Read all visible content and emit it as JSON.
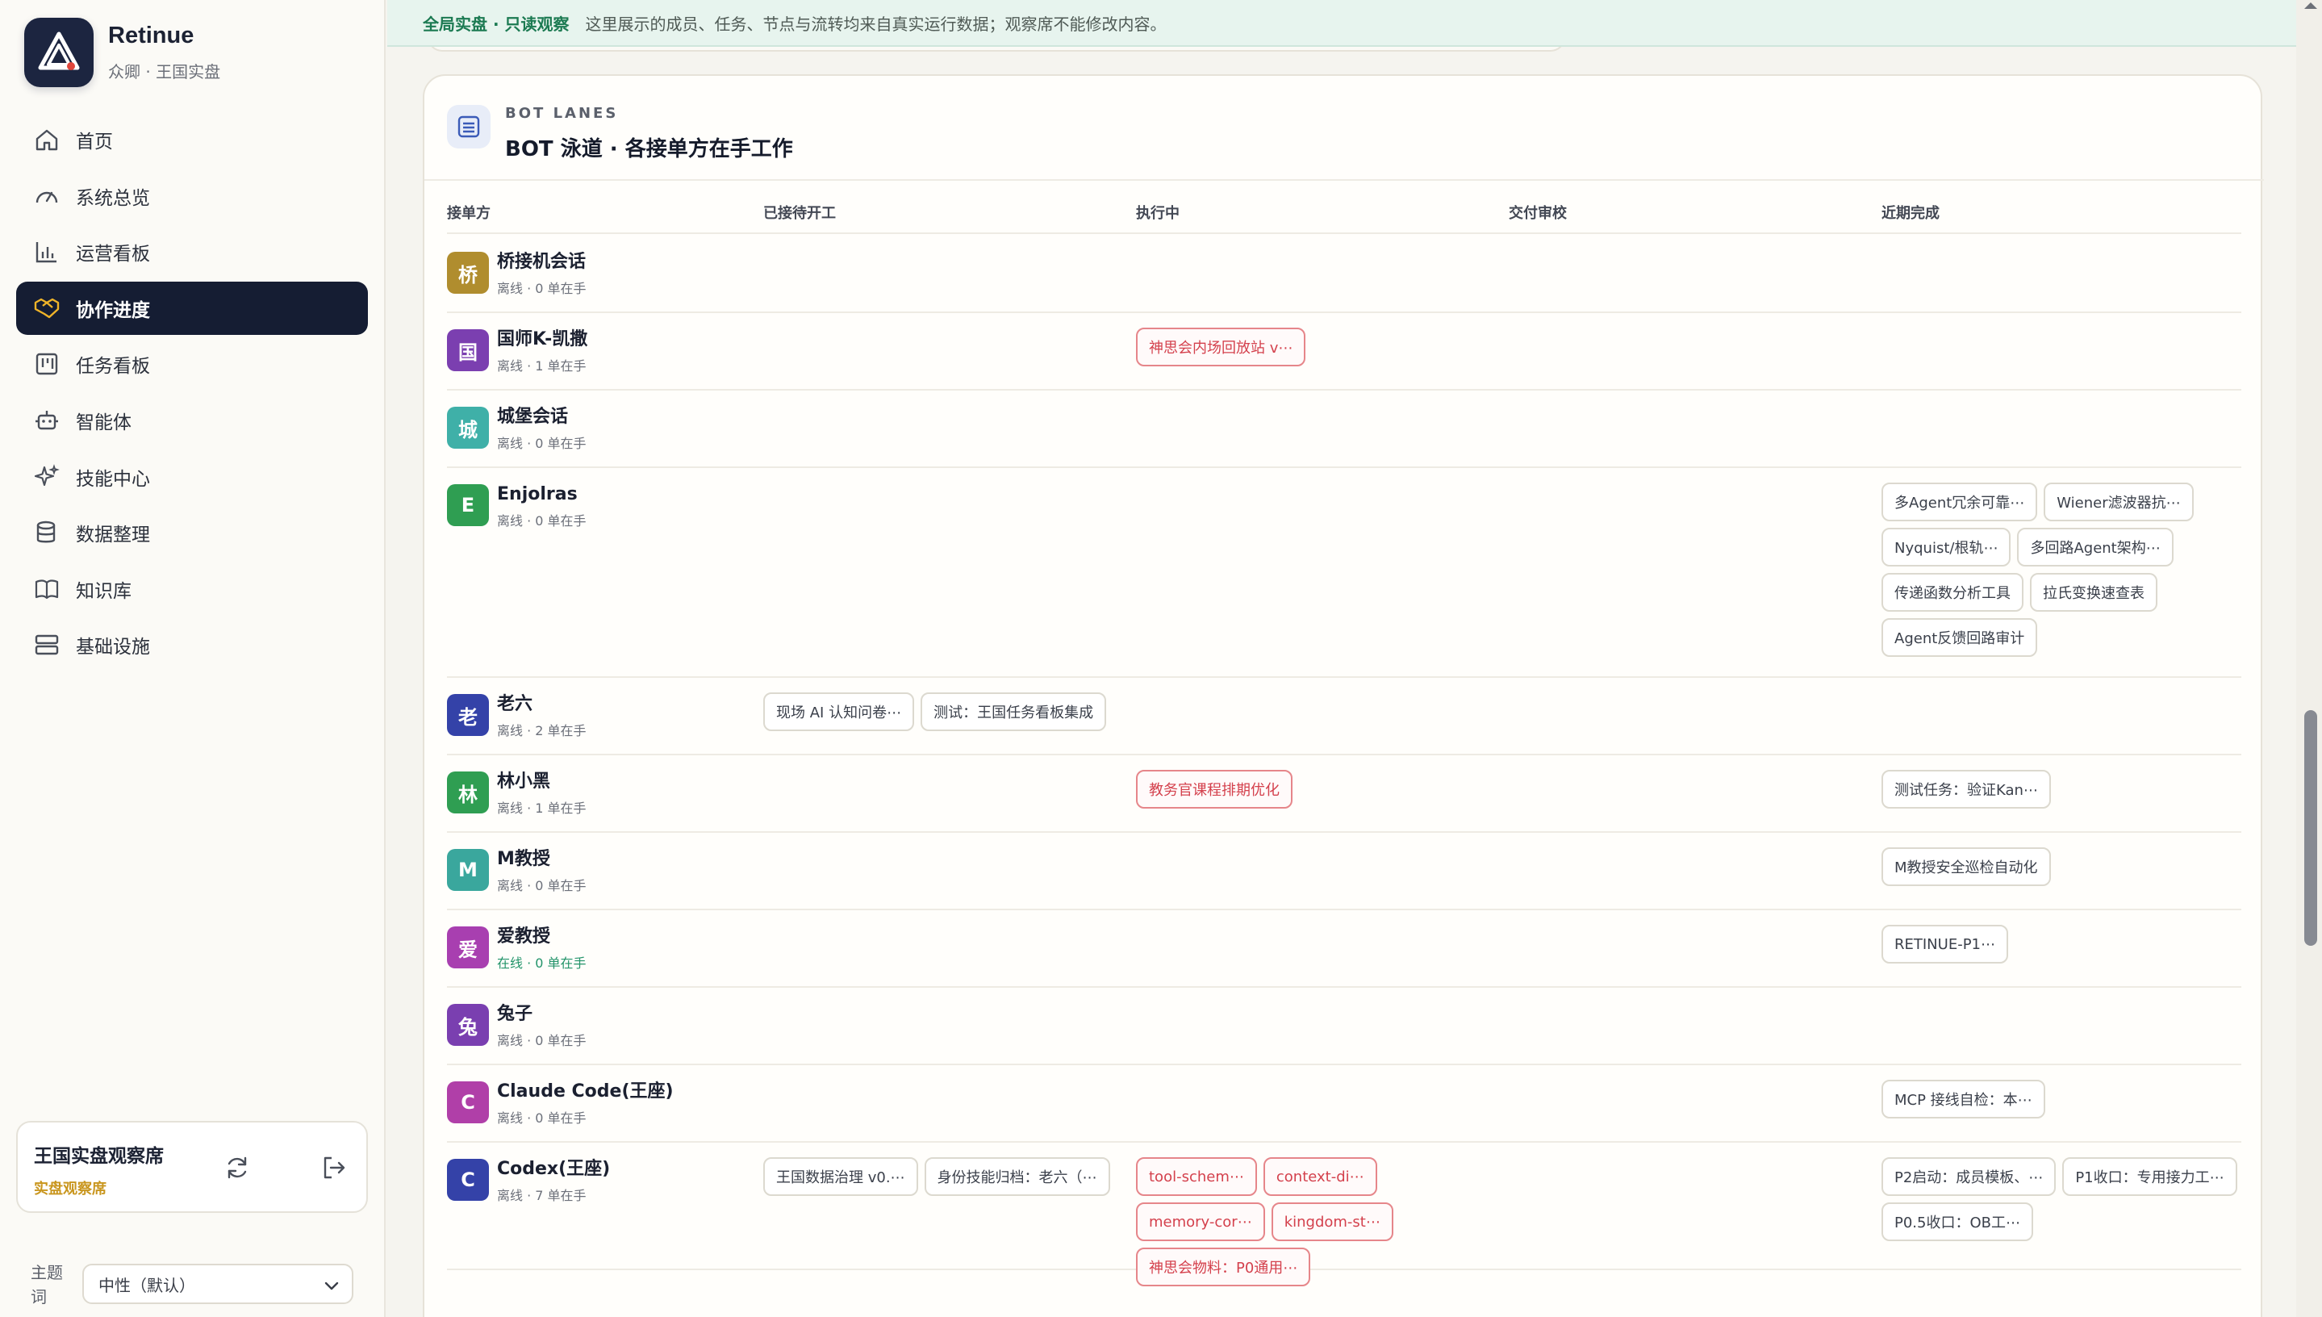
{
  "app": {
    "title": "Retinue",
    "subtitle": "众卿 · 王国实盘"
  },
  "sidebar": {
    "items": [
      {
        "label": "首页",
        "icon": "home-icon",
        "active": false
      },
      {
        "label": "系统总览",
        "icon": "gauge-icon",
        "active": false
      },
      {
        "label": "运营看板",
        "icon": "bar-chart-icon",
        "active": false
      },
      {
        "label": "协作进度",
        "icon": "handshake-icon",
        "active": true
      },
      {
        "label": "任务看板",
        "icon": "kanban-icon",
        "active": false
      },
      {
        "label": "智能体",
        "icon": "robot-icon",
        "active": false
      },
      {
        "label": "技能中心",
        "icon": "sparkle-icon",
        "active": false
      },
      {
        "label": "数据整理",
        "icon": "database-icon",
        "active": false
      },
      {
        "label": "知识库",
        "icon": "book-icon",
        "active": false
      },
      {
        "label": "基础设施",
        "icon": "server-icon",
        "active": false
      }
    ],
    "observer": {
      "title": "王国实盘观察席",
      "subtitle": "实盘观察席"
    },
    "theme": {
      "label": "主题词",
      "value": "中性（默认）"
    }
  },
  "banner": {
    "strong": "全局实盘 · 只读观察",
    "text": "这里展示的成员、任务、节点与流转均来自真实运行数据；观察席不能修改内容。"
  },
  "panel": {
    "kicker": "BOT LANES",
    "title": "BOT 泳道 · 各接单方在手工作",
    "columns": [
      "接单方",
      "已接待开工",
      "执行中",
      "交付审校",
      "近期完成"
    ]
  },
  "lanes": [
    {
      "avatar": "桥",
      "color": "#b08d2e",
      "name": "桥接机会话",
      "status": "离线 · 0 单在手",
      "online": false,
      "waiting": [],
      "executing": [],
      "review": [],
      "done": []
    },
    {
      "avatar": "国",
      "color": "#7b3fb0",
      "name": "国师K-凯撒",
      "status": "离线 · 1 单在手",
      "online": false,
      "waiting": [],
      "executing": [
        "神思会内场回放站 v⋯"
      ],
      "review": [],
      "done": []
    },
    {
      "avatar": "城",
      "color": "#3fb0a8",
      "name": "城堡会话",
      "status": "离线 · 0 单在手",
      "online": false,
      "waiting": [],
      "executing": [],
      "review": [],
      "done": []
    },
    {
      "avatar": "E",
      "color": "#2f9e52",
      "name": "Enjolras",
      "status": "离线 · 0 单在手",
      "online": false,
      "waiting": [],
      "executing": [],
      "review": [],
      "done": [
        "多Agent冗余可靠⋯",
        "Wiener滤波器抗⋯",
        "Nyquist/根轨⋯",
        "多回路Agent架构⋯",
        "传递函数分析工具",
        "拉氏变换速查表",
        "Agent反馈回路审计"
      ]
    },
    {
      "avatar": "老",
      "color": "#3442a8",
      "name": "老六",
      "status": "离线 · 2 单在手",
      "online": false,
      "waiting": [
        "现场 AI 认知问卷⋯",
        "测试：王国任务看板集成"
      ],
      "executing": [],
      "review": [],
      "done": []
    },
    {
      "avatar": "林",
      "color": "#2f9e52",
      "name": "林小黑",
      "status": "离线 · 1 单在手",
      "online": false,
      "waiting": [],
      "executing": [
        "教务官课程排期优化"
      ],
      "review": [],
      "done": [
        "测试任务：验证Kan⋯"
      ]
    },
    {
      "avatar": "M",
      "color": "#3aa79d",
      "name": "M教授",
      "status": "离线 · 0 单在手",
      "online": false,
      "waiting": [],
      "executing": [],
      "review": [],
      "done": [
        "M教授安全巡检自动化"
      ]
    },
    {
      "avatar": "爱",
      "color": "#a83fb0",
      "name": "爱教授",
      "status": "在线 · 0 单在手",
      "online": true,
      "waiting": [],
      "executing": [],
      "review": [],
      "done": [
        "RETINUE-P1⋯"
      ]
    },
    {
      "avatar": "兔",
      "color": "#7a3fb0",
      "name": "兔子",
      "status": "离线 · 0 单在手",
      "online": false,
      "waiting": [],
      "executing": [],
      "review": [],
      "done": []
    },
    {
      "avatar": "C",
      "color": "#b03fa8",
      "name": "Claude Code(王座)",
      "status": "离线 · 0 单在手",
      "online": false,
      "waiting": [],
      "executing": [],
      "review": [],
      "done": [
        "MCP 接线自检：本⋯"
      ]
    },
    {
      "avatar": "C",
      "color": "#3442a8",
      "name": "Codex(王座)",
      "status": "离线 · 7 单在手",
      "online": false,
      "waiting": [
        "王国数据治理 v0.⋯",
        "身份技能归档：老六（⋯"
      ],
      "executing": [
        "tool-schem⋯",
        "context-di⋯",
        "memory-cor⋯",
        "kingdom-st⋯",
        "神思会物料：P0通用⋯"
      ],
      "review": [],
      "done": [
        "P2启动：成员模板、⋯",
        "P1收口：专用接力工⋯",
        "P0.5收口：OB工⋯"
      ]
    }
  ]
}
